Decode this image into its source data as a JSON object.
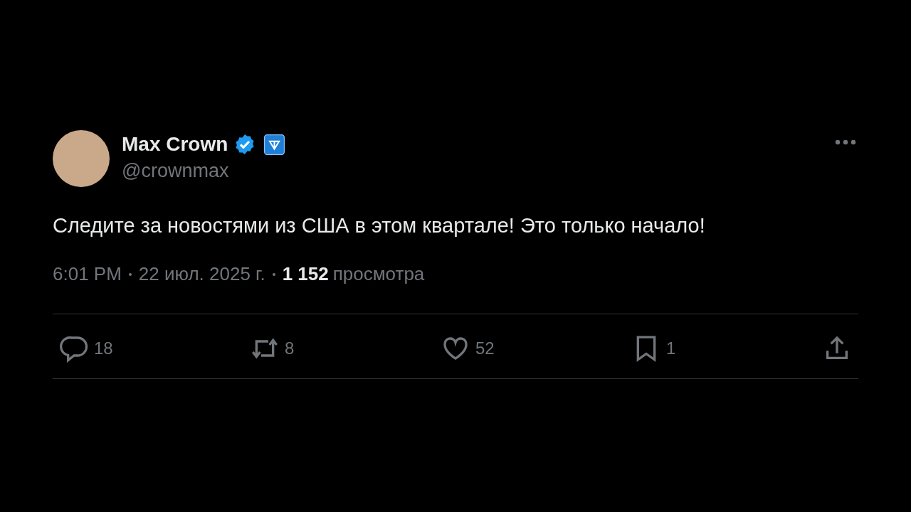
{
  "author": {
    "name": "Max Crown",
    "handle": "@crownmax",
    "verified": true,
    "affiliate_badge": true
  },
  "text": "Следите за новостями из США в этом квартале! Это только начало!",
  "meta": {
    "time": "6:01 PM",
    "date": "22 июл. 2025 г.",
    "views_count": "1 152",
    "views_label": "просмотра"
  },
  "actions": [
    {
      "kind": "reply",
      "count": "18"
    },
    {
      "kind": "repost",
      "count": "8"
    },
    {
      "kind": "like",
      "count": "52"
    },
    {
      "kind": "bookmark",
      "count": "1"
    },
    {
      "kind": "share"
    }
  ]
}
